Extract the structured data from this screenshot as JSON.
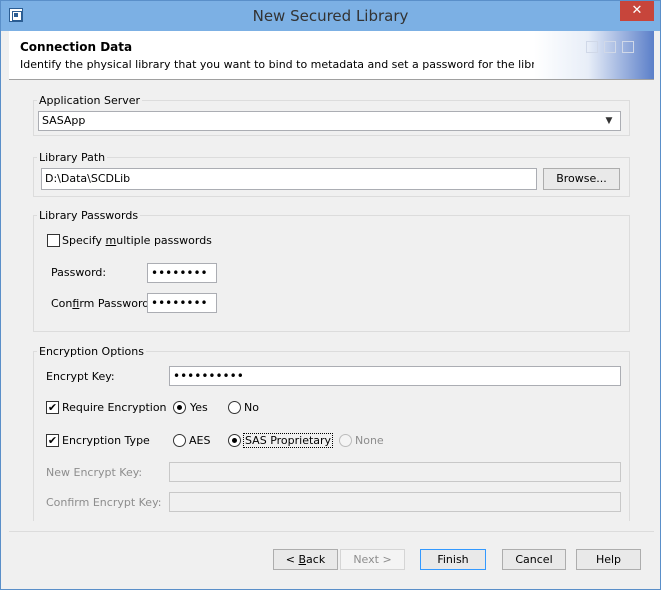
{
  "window": {
    "title": "New Secured Library",
    "close": "✕"
  },
  "banner": {
    "title": "Connection Data",
    "description": "Identify the physical library that you want to bind to metadata and set a password for the library"
  },
  "app_server": {
    "legend": "Application Server",
    "value": "SASApp"
  },
  "library_path": {
    "legend": "Library Path",
    "value": "D:\\Data\\SCDLib",
    "browse": "Browse..."
  },
  "passwords": {
    "legend": "Library Passwords",
    "multiple_label_pre": "Specify ",
    "multiple_label_u": "m",
    "multiple_label_post": "ultiple passwords",
    "multiple_checked": false,
    "password_label": "Password:",
    "password_value": "••••••••",
    "confirm_label_pre": "Con",
    "confirm_label_u": "f",
    "confirm_label_post": "irm Password:",
    "confirm_value": "••••••••"
  },
  "encryption": {
    "legend": "Encryption Options",
    "encrypt_key_label": "Encrypt Key:",
    "encrypt_key_value": "••••••••••",
    "require_label": "Require Encryption",
    "require_checked": "✔",
    "yes_label": "Yes",
    "no_label": "No",
    "type_label": "Encryption Type",
    "type_checked": "✔",
    "aes_label": "AES",
    "sas_label": "SAS Proprietary",
    "none_label": "None",
    "new_key_label": "New Encrypt Key:",
    "confirm_key_label": "Confirm Encrypt Key:"
  },
  "footer": {
    "back_pre": "< ",
    "back_u": "B",
    "back_post": "ack",
    "next_label": "Next >",
    "finish_label": "Finish",
    "cancel_label": "Cancel",
    "help_label": "Help"
  }
}
